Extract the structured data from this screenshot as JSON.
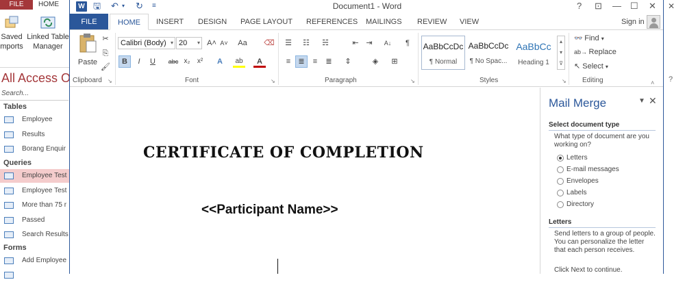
{
  "access": {
    "file_tab": "FILE",
    "home_tab": "HOME",
    "ribbon": {
      "saved_imports_line1": "Saved",
      "saved_imports_line2": "mports",
      "linked_table_line1": "Linked Table",
      "linked_table_line2": "Manager"
    },
    "nav_title": "All Access O",
    "search_placeholder": "Search...",
    "sections": {
      "tables": "Tables",
      "queries": "Queries",
      "forms": "Forms"
    },
    "tables": [
      "Employee",
      "Results",
      "Borang Enquir"
    ],
    "queries": [
      "Employee Test",
      "Employee Test",
      "More than 75 r",
      "Passed",
      "Search Results"
    ],
    "forms": [
      "Add Employee"
    ],
    "window_controls": "✕",
    "help": "?"
  },
  "word": {
    "title": "Document1 - Word",
    "quick_access": {
      "save": "🖫",
      "undo": "↶",
      "undo_arrow": "▾",
      "redo": "↻",
      "customize": "≡"
    },
    "window_controls": {
      "help": "?",
      "ribbon_display": "⊡",
      "minimize": "—",
      "maximize": "☐",
      "close": "✕"
    },
    "tabs": {
      "file": "FILE",
      "items": [
        "HOME",
        "INSERT",
        "DESIGN",
        "PAGE LAYOUT",
        "REFERENCES",
        "MAILINGS",
        "REVIEW",
        "VIEW"
      ]
    },
    "sign_in": "Sign in",
    "ribbon": {
      "clipboard": {
        "paste": "Paste",
        "label": "Clipboard"
      },
      "font": {
        "family": "Calibri (Body)",
        "size": "20",
        "grow": "A˄",
        "shrink": "A˅",
        "change_case": "Aa",
        "clear": "⌫",
        "bold": "B",
        "italic": "I",
        "underline": "U",
        "strike": "abc",
        "subscript": "x₂",
        "superscript": "x²",
        "text_effects": "A",
        "highlight": "ab",
        "font_color": "A",
        "label": "Font"
      },
      "paragraph": {
        "bullets": "☰",
        "numbering": "☷",
        "multilevel": "☵",
        "decrease_indent": "⇤",
        "increase_indent": "⇥",
        "sort": "A↓",
        "show_marks": "¶",
        "align_left": "≡",
        "center": "≣",
        "align_right": "≡",
        "justify": "≣",
        "line_spacing": "⇕",
        "shading": "◈",
        "borders": "⊞",
        "label": "Paragraph"
      },
      "styles": {
        "items": [
          {
            "preview": "AaBbCcDc",
            "name": "¶ Normal"
          },
          {
            "preview": "AaBbCcDc",
            "name": "¶ No Spac..."
          },
          {
            "preview": "AaBbCc",
            "name": "Heading 1"
          }
        ],
        "label": "Styles"
      },
      "editing": {
        "find": "Find",
        "replace": "Replace",
        "select": "Select",
        "label": "Editing"
      }
    },
    "document": {
      "title": "CERTIFICATE OF COMPLETION",
      "participant_field": "<<Participant Name>>"
    },
    "mail_merge": {
      "title": "Mail Merge",
      "select_type_heading": "Select document type",
      "question": "What type of document are you working on?",
      "options": [
        {
          "label": "Letters",
          "selected": true
        },
        {
          "label": "E-mail messages",
          "selected": false
        },
        {
          "label": "Envelopes",
          "selected": false
        },
        {
          "label": "Labels",
          "selected": false
        },
        {
          "label": "Directory",
          "selected": false
        }
      ],
      "letters_heading": "Letters",
      "letters_desc": "Send letters to a group of people. You can personalize the letter that each person receives.",
      "next_hint": "Click Next to continue."
    }
  },
  "colors": {
    "word_blue": "#2b579a",
    "access_red": "#a4373a"
  }
}
